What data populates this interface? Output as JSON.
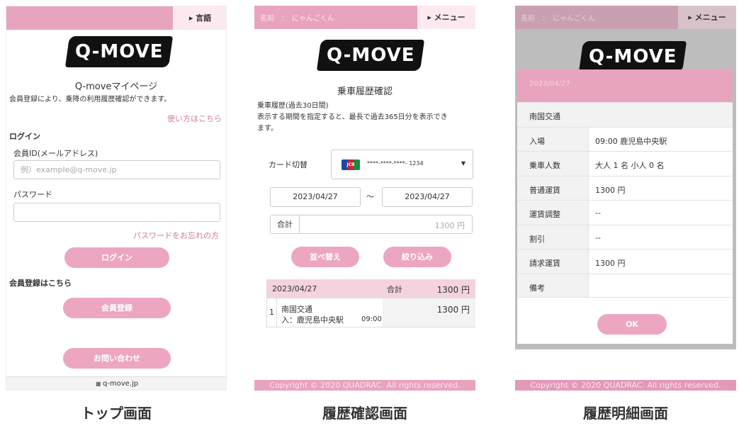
{
  "top": {
    "lang": "▸ 言語",
    "logo": "Q-MOVE",
    "title": "Q-moveマイページ",
    "desc": "会員登録により、乗降の利用履歴確認ができます。",
    "howto": "使い方はこちら",
    "login_heading": "ログイン",
    "id_label": "会員ID(メールアドレス)",
    "id_placeholder": "例）example@q-move.jp",
    "pw_label": "パスワード",
    "forgot": "パスワードをお忘れの方",
    "login_btn": "ログイン",
    "register_heading": "会員登録はこちら",
    "register_btn": "会員登録",
    "contact_btn": "お問い合わせ",
    "url": "q-move.jp"
  },
  "history": {
    "name": "名前　：　にゃんごくん",
    "menu": "▸ メニュー",
    "logo": "Q-MOVE",
    "title": "乗車履歴確認",
    "desc1": "乗車履歴(過去30日間)",
    "desc2": "表示する期間を指定すると、最長で過去365日分を表示でき",
    "desc3": "ます。",
    "card_label": "カード切替",
    "card_brand": "JCB",
    "card_number": "****-****-****- 1234",
    "date_from": "2023/04/27",
    "date_sep": "～",
    "date_to": "2023/04/27",
    "total_label": "合計",
    "total_value": "1300 円",
    "sort_btn": "並べ替え",
    "filter_btn": "絞り込み",
    "table_date": "2023/04/27",
    "table_total_label": "合計",
    "table_total": "1300 円",
    "row_no": "1",
    "row_company": "南国交通",
    "row_station": "入：鹿児島中央駅",
    "row_time": "09:00",
    "row_amount": "1300 円",
    "copyright": "Copyright © 2020 QUADRAC. All rights reserved."
  },
  "detail": {
    "name": "名前　：　にゃんごくん",
    "menu": "▸ メニュー",
    "logo": "Q-MOVE",
    "date": "2023/04/27",
    "company": "南国交通",
    "rows": [
      {
        "k": "入場",
        "v": "09:00 鹿児島中央駅"
      },
      {
        "k": "乗車人数",
        "v": "大人 1 名  小人 0 名"
      },
      {
        "k": "普通運賃",
        "v": "1300 円"
      },
      {
        "k": "運賃調整",
        "v": "--"
      },
      {
        "k": "割引",
        "v": "--"
      },
      {
        "k": "請求運賃",
        "v": "1300 円"
      },
      {
        "k": "備考",
        "v": ""
      }
    ],
    "ok_btn": "OK",
    "copyright": "Copyright © 2020 QUADRAC. All rights reserved."
  },
  "captions": [
    "トップ画面",
    "履歴確認画面",
    "履歴明細画面"
  ]
}
